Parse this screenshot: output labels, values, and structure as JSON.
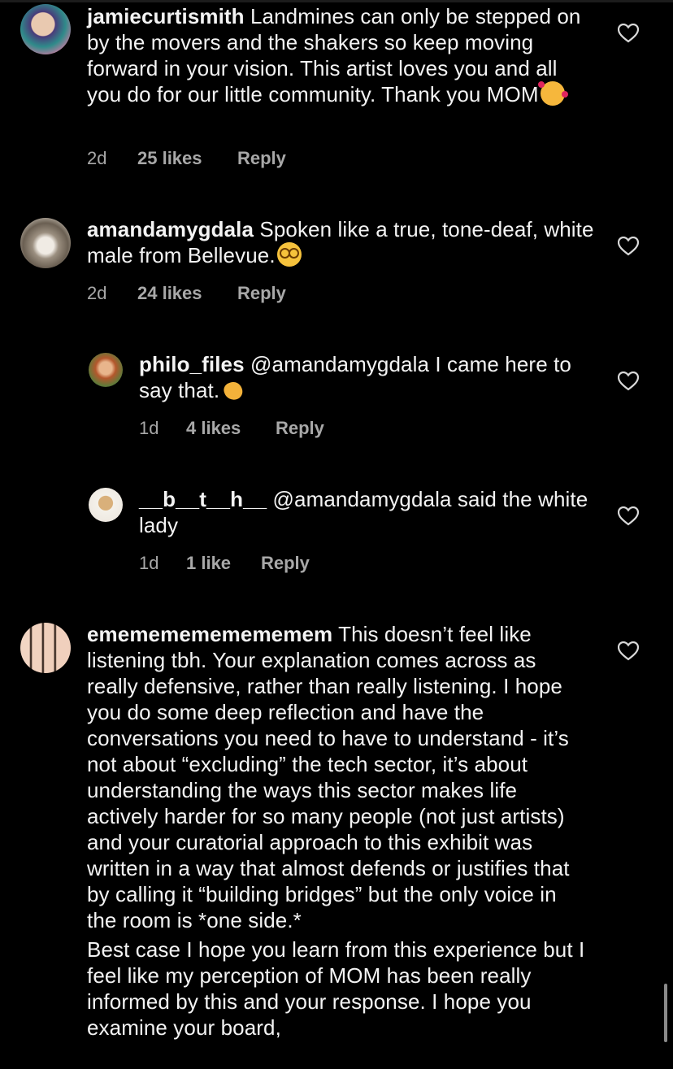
{
  "comments": [
    {
      "username": "jamiecurtismith",
      "text": " Landmines can only be stepped on by the movers and the shakers so keep moving forward in your vision. This artist loves you and all you do for our little community. Thank you MOM",
      "emoji": "smiling-face-with-hearts",
      "time": "2d",
      "likes": "25 likes",
      "reply": "Reply"
    },
    {
      "username": "amandamygdala",
      "text": " Spoken like a true, tone-deaf, white male from Bellevue.",
      "emoji": "face-with-spiral-eyes",
      "time": "2d",
      "likes": "24 likes",
      "reply": "Reply"
    },
    {
      "username": "philo_files",
      "text": " @amandamygdala I came here to say that.",
      "emoji": "clapping-hands",
      "time": "1d",
      "likes": "4 likes",
      "reply": "Reply"
    },
    {
      "username": "__b__t__h__",
      "text": " @amandamygdala said the white lady",
      "time": "1d",
      "likes": "1 like",
      "reply": "Reply"
    },
    {
      "username": "emememememememem",
      "text": " This doesn’t feel like listening tbh. Your explanation comes across as really defensive, rather than really listening. I hope you do some deep reflection and have the conversations you need to have to understand - it’s not about “excluding” the tech sector, it’s about understanding the ways this sector makes life actively harder for so many people (not just artists) and your curatorial approach to this exhibit was written in a way that almost defends or justifies that by calling it “building bridges” but the only voice in the room is *one side.*",
      "text2": "Best case I hope you learn from this experience but I feel like my perception of MOM has been really informed by this and your response. I hope you examine your board,"
    }
  ],
  "colors": {
    "background": "#000000",
    "text": "#f3f3f3",
    "meta": "#a8a8a8"
  }
}
